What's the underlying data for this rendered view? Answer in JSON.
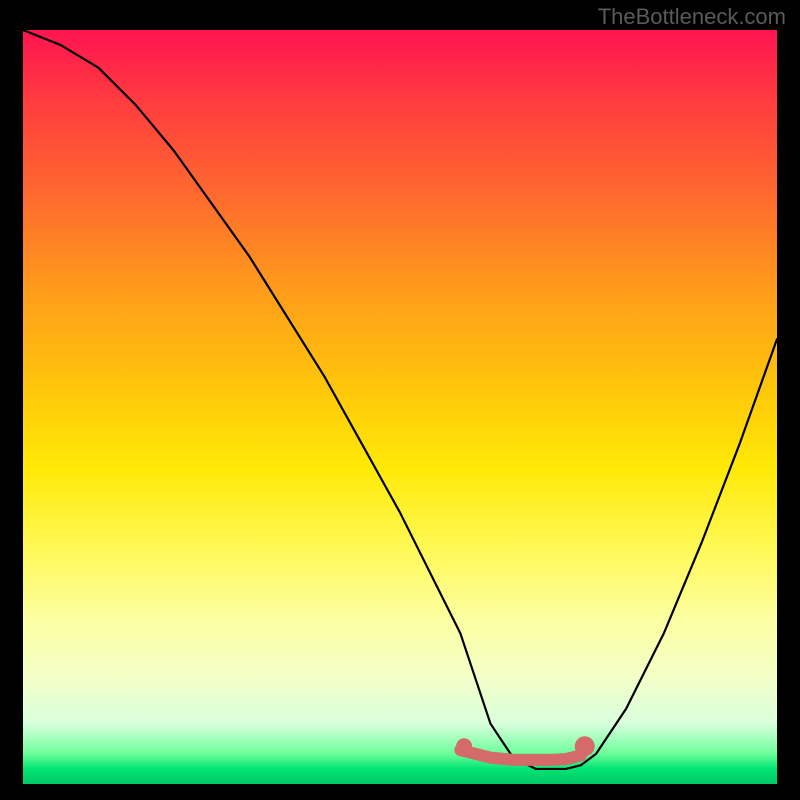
{
  "watermark": "TheBottleneck.com",
  "chart_data": {
    "type": "line",
    "title": "",
    "xlabel": "",
    "ylabel": "",
    "xlim": [
      0,
      100
    ],
    "ylim": [
      0,
      100
    ],
    "series": [
      {
        "name": "curve",
        "color": "#000000",
        "x": [
          0,
          5,
          10,
          15,
          20,
          25,
          30,
          35,
          40,
          45,
          50,
          55,
          58,
          60,
          62,
          65,
          68,
          70,
          72,
          74,
          76,
          80,
          85,
          90,
          95,
          100
        ],
        "values": [
          100,
          98,
          95,
          90,
          84,
          77,
          70,
          62,
          54,
          45,
          36,
          26,
          20,
          14,
          8,
          3.5,
          2,
          2,
          2,
          2.5,
          4,
          10,
          20,
          32,
          45,
          59
        ]
      },
      {
        "name": "highlight",
        "color": "#d46a6a",
        "x": [
          58,
          60,
          62,
          65,
          68,
          70,
          72,
          74
        ],
        "values": [
          4.5,
          4,
          3.5,
          3.2,
          3.2,
          3.2,
          3.3,
          3.8
        ]
      }
    ],
    "points": [
      {
        "name": "highlight-start",
        "x": 58.5,
        "y": 5,
        "color": "#d46a6a"
      },
      {
        "name": "highlight-end",
        "x": 74.5,
        "y": 5,
        "color": "#d46a6a"
      }
    ]
  }
}
